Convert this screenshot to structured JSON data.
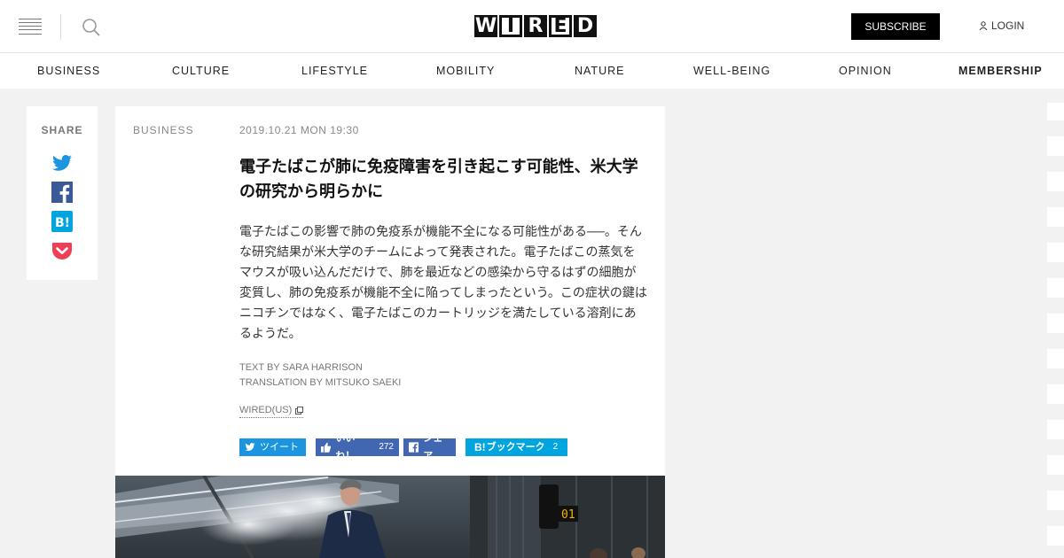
{
  "header": {
    "logo": [
      "W",
      "I",
      "R",
      "E",
      "D"
    ],
    "subscribe": "SUBSCRIBE",
    "login": "LOGIN",
    "icons": {
      "menu": "hamburger-icon",
      "search": "search-icon",
      "user": "user-icon"
    }
  },
  "nav": {
    "items": [
      "BUSINESS",
      "CULTURE",
      "LIFESTYLE",
      "MOBILITY",
      "NATURE",
      "WELL-BEING",
      "OPINION",
      "MEMBERSHIP"
    ]
  },
  "share": {
    "label": "SHARE",
    "icons": [
      "twitter-icon",
      "facebook-icon",
      "hatena-bookmark-icon",
      "pocket-icon"
    ]
  },
  "article": {
    "category": "BUSINESS",
    "date": "2019.10.21 MON 19:30",
    "title": "電子たばこが肺に免疫障害を引き起こす可能性、米大学の研究から明らかに",
    "lead": "電子たばこの影響で肺の免疫系が機能不全になる可能性がある──。そんな研究結果が米大学のチームによって発表された。電子たばこの蒸気をマウスが吸い込んだだけで、肺を最近などの感染から守るはずの細胞が変質し、肺の免疫系が機能不全に陥ってしまったという。この症状の鍵はニコチンではなく、電子たばこのカートリッジを満たしている溶剤にあるようだ。",
    "text_by": "TEXT BY SARA HARRISON",
    "translation_by": "TRANSLATION BY MITSUKO SAEKI",
    "source": "WIRED(US)"
  },
  "social": {
    "tweet": "ツイート",
    "like": "いいね！",
    "like_count": "272",
    "share": "シェア",
    "bookmark": "ブックマーク",
    "bookmark_count": "2",
    "colors": {
      "twitter": "#1b95e0",
      "facebook": "#4267b2",
      "hatena": "#00a4de",
      "pocket": "#ef3f56"
    }
  },
  "photo": {
    "signal_text": "01"
  }
}
